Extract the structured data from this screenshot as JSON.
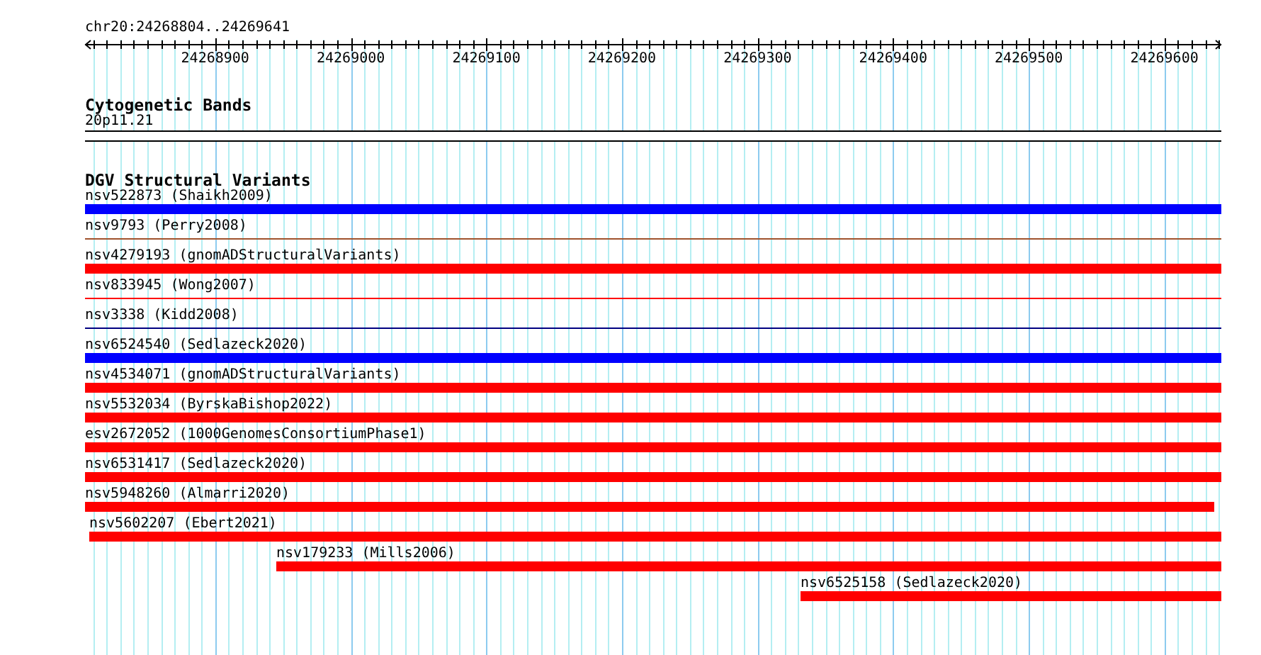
{
  "ruler": {
    "position": "chr20:24268804..24269641",
    "tick_labels": [
      "24268900",
      "24269000",
      "24269100",
      "24269200",
      "24269300",
      "24269400",
      "24269500",
      "24269600"
    ]
  },
  "cytogenetic_bands": {
    "title": "Cytogenetic Bands",
    "band": "20p11.21"
  },
  "dgv_structural_variants": {
    "title": "DGV Structural Variants",
    "variants": [
      {
        "label": "nsv522873 (Shaikh2009)",
        "kind": "bar",
        "color": "#0000ff",
        "level": 1
      },
      {
        "label": "nsv9793 (Perry2008)",
        "kind": "line",
        "color": "#a0522d",
        "level": 1
      },
      {
        "label": "nsv4279193 (gnomADStructuralVariants)",
        "kind": "bar",
        "color": "#ff0000",
        "level": 1
      },
      {
        "label": "nsv833945 (Wong2007)",
        "kind": "line",
        "color": "#ff0000",
        "level": 1
      },
      {
        "label": "nsv3338 (Kidd2008)",
        "kind": "line",
        "color": "#000080",
        "level": 1
      },
      {
        "label": "nsv6524540 (Sedlazeck2020)",
        "kind": "bar",
        "color": "#0000ff",
        "level": 1
      },
      {
        "label": "nsv4534071 (gnomADStructuralVariants)",
        "kind": "bar",
        "color": "#ff0000",
        "level": 1
      },
      {
        "label": "nsv5532034 (ByrskaBishop2022)",
        "kind": "bar",
        "color": "#ff0000",
        "level": 1
      },
      {
        "label": "esv2672052 (1000GenomesConsortiumPhase1)",
        "kind": "bar",
        "color": "#ff0000",
        "level": 1
      },
      {
        "label": "nsv6531417 (Sedlazeck2020)",
        "kind": "bar",
        "color": "#ff0000",
        "level": 1
      },
      {
        "label": "nsv5948260 (Almarri2020)",
        "kind": "bar",
        "color": "#ff0000",
        "level": 0.994
      },
      {
        "label": "nsv5602207 (Ebert2021)",
        "kind": "tailbar",
        "color": "#ff0000",
        "level": 0.996
      },
      {
        "label": "nsv179233 (Mills2006)",
        "kind": "tailbar",
        "color": "#ff0000",
        "level": 0.832
      },
      {
        "label": "nsv6525158 (Sedlazeck2020)",
        "kind": "tailbar",
        "color": "#ff0000",
        "level": 0.37
      }
    ]
  }
}
